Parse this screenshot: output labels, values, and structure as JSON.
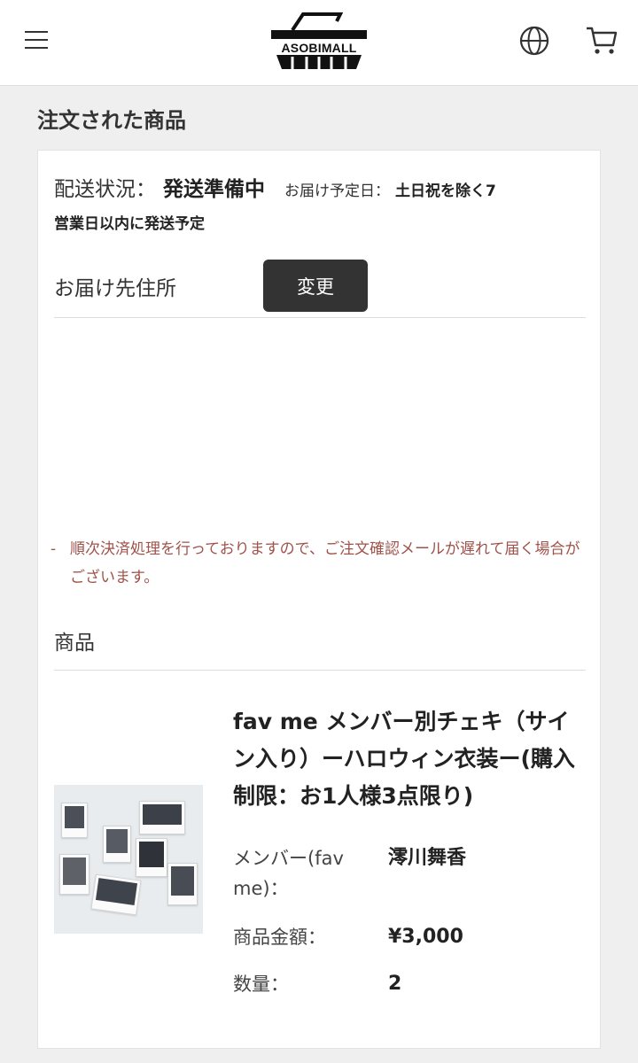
{
  "header": {
    "logo_text": "ASOBIMALL",
    "icons": [
      "hamburger-menu-icon",
      "globe-icon",
      "cart-icon",
      "basket-logo-icon"
    ]
  },
  "section": {
    "title": "注文された商品"
  },
  "order": {
    "status_label": "配送状況：",
    "status_value": "発送準備中",
    "eta_label": "お届け予定日：",
    "eta_value": "土日祝を除く7",
    "eta_value_cont": "営業日以内に発送予定",
    "address_label": "お届け先住所",
    "change_button": "変更",
    "notice_dash": "-",
    "notice": "順次決済処理を行っておりますので、ご注文確認メールが遅れて届く場合がございます。"
  },
  "products": {
    "label": "商品",
    "items": [
      {
        "title": "fav me メンバー別チェキ（サイン入り）ーハロウィン衣装ー(購入制限：お1人様3点限り)",
        "member_label": "メンバー(fav me)：",
        "member_value": "澪川舞香",
        "price_label": "商品金額：",
        "price_value": "¥3,000",
        "qty_label": "数量：",
        "qty_value": "2"
      }
    ]
  },
  "colors": {
    "background": "#efefef",
    "card": "#ffffff",
    "button": "#333333",
    "notice_text": "#a0524a"
  }
}
